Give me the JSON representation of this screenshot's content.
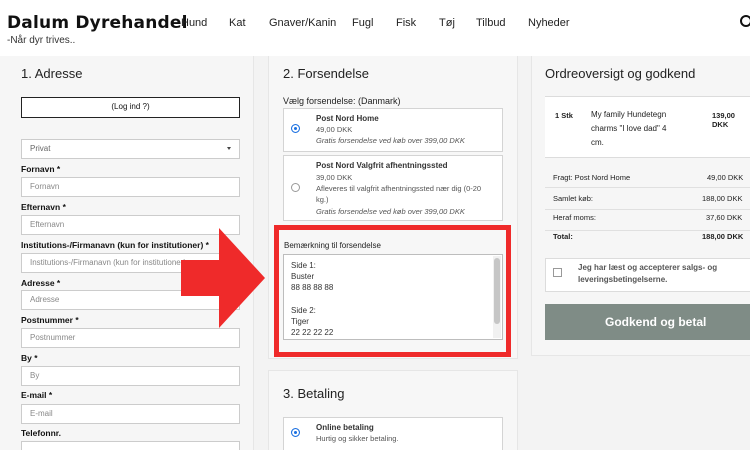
{
  "header": {
    "brand": "Dalum Dyrehandel",
    "tagline": "-Når dyr trives..",
    "nav": [
      "Hund",
      "Kat",
      "Gnaver/Kanin",
      "Fugl",
      "Fisk",
      "Tøj",
      "Tilbud",
      "Nyheder"
    ]
  },
  "address": {
    "title": "1. Adresse",
    "login_label": "(Log ind ?)",
    "customer_type": "Privat",
    "fields": [
      {
        "label": "Fornavn *",
        "placeholder": "Fornavn"
      },
      {
        "label": "Efternavn *",
        "placeholder": "Efternavn"
      },
      {
        "label": "Institutions-/Firmanavn (kun for institutioner) *",
        "placeholder": "Institutions-/Firmanavn (kun for institutioner)"
      },
      {
        "label": "Adresse *",
        "placeholder": "Adresse"
      },
      {
        "label": "Postnummer *",
        "placeholder": "Postnummer"
      },
      {
        "label": "By *",
        "placeholder": "By"
      },
      {
        "label": "E-mail *",
        "placeholder": "E-mail"
      },
      {
        "label": "Telefonnr.",
        "placeholder": ""
      }
    ]
  },
  "shipping": {
    "title": "2. Forsendelse",
    "choose_label": "Vælg forsendelse: (Danmark)",
    "options": [
      {
        "title": "Post Nord Home",
        "price": "49,00 DKK",
        "lines": [],
        "note": "Gratis forsendelse ved køb over 399,00 DKK",
        "selected": true
      },
      {
        "title": "Post Nord Valgfrit afhentningssted",
        "price": "39,00 DKK",
        "lines": [
          "Afleveres til valgfrit afhentningssted nær dig (0-20",
          "kg.)"
        ],
        "note": "Gratis forsendelse ved køb over 399,00 DKK",
        "selected": false
      }
    ],
    "remark_label": "Bemærkning til forsendelse",
    "remark_lines": [
      "Side 1:",
      "Buster",
      "88 88 88 88",
      "",
      "Side 2:",
      "Tiger",
      "22 22 22 22"
    ]
  },
  "payment": {
    "title": "3. Betaling",
    "option_title": "Online betaling",
    "option_sub": "Hurtig og sikker betaling."
  },
  "order": {
    "title": "Ordreoversigt og godkend",
    "item_qty": "1 Stk",
    "item_name_lines": [
      "My family Hundetegn",
      "charms \"I love dad\" 4",
      "cm."
    ],
    "item_price": "139,00 DKK",
    "summary": [
      {
        "label": "Fragt: Post Nord Home",
        "value": "49,00 DKK",
        "bold": false
      },
      {
        "label": "Samlet køb:",
        "value": "188,00 DKK",
        "bold": false
      },
      {
        "label": "Heraf moms:",
        "value": "37,60 DKK",
        "bold": false
      },
      {
        "label": "Total:",
        "value": "188,00 DKK",
        "bold": true
      }
    ],
    "terms_lines": [
      "Jeg har læst og accepterer salgs- og",
      "leveringsbetingelserne."
    ],
    "approve_label": "Godkend og betal"
  },
  "colors": {
    "highlight": "#ef2a2a",
    "approve_button": "#7f8c86",
    "radio_selected": "#1a6fe0"
  }
}
